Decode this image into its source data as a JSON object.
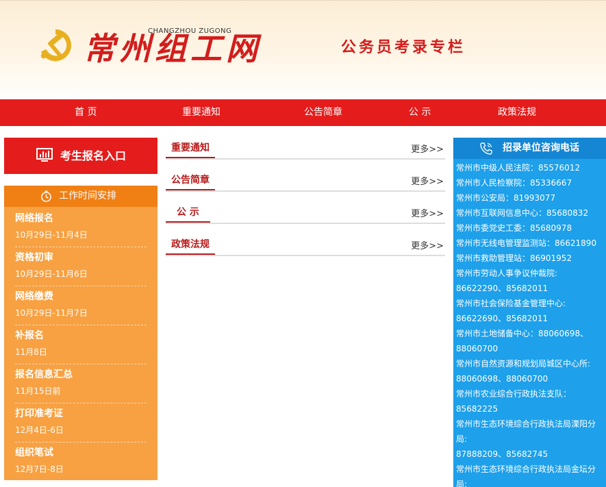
{
  "header": {
    "logo_text": "常州组工网",
    "logo_sub": "CHANGZHOU ZUGONG",
    "column_title": "公务员考录专栏"
  },
  "nav": {
    "items": [
      "首 页",
      "重要通知",
      "公告简章",
      "公 示",
      "政策法规"
    ]
  },
  "apply": {
    "label": "考生报名入口",
    "icon": "chart-screen-icon"
  },
  "schedule": {
    "title": "工作时间安排",
    "icon": "clock-icon",
    "items": [
      {
        "name": "网络报名",
        "date": "10月29日-11月4日"
      },
      {
        "name": "资格初审",
        "date": "10月29日-11月6日"
      },
      {
        "name": "网络缴费",
        "date": "10月29日-11月7日"
      },
      {
        "name": "补报名",
        "date": "11月8日"
      },
      {
        "name": "报名信息汇总",
        "date": "11月15日前"
      },
      {
        "name": "打印准考证",
        "date": "12月4日-6日"
      },
      {
        "name": "组织笔试",
        "date": "12月7日-8日"
      }
    ]
  },
  "sections": [
    {
      "title": "重要通知",
      "more": "更多>>"
    },
    {
      "title": "公告简章",
      "more": "更多>>"
    },
    {
      "title": "公 示",
      "more": "更多>>"
    },
    {
      "title": "政策法规",
      "more": "更多>>"
    }
  ],
  "phones": {
    "title": "招录单位咨询电话",
    "icon": "phone-icon",
    "lines": [
      "常州市中级人民法院：85576012",
      "常州市人民检察院：85336667",
      "常州市公安局：81993077",
      "常州市互联网信息中心：85680832",
      "常州市委党史工委：85680978",
      "常州市无线电管理监测站：86621890",
      "常州市救助管理站：86901952",
      "常州市劳动人事争议仲裁院:",
      "86622290、85682011",
      "常州市社会保险基金管理中心:",
      "86622690、85682011",
      "常州市土地储备中心：88060698、",
      "88060700",
      "常州市自然资源和规划局城区中心所:",
      "88060698、88060700",
      "常州市农业综合行政执法支队：",
      "85682225",
      "常州市生态环境综合行政执法局溧阳分",
      "局:",
      "87888209、85682745",
      "常州市生态环境综合行政执法局金坛分",
      "局:"
    ]
  },
  "colors": {
    "brand_red": "#e41c1c",
    "orange": "#f7a143",
    "orange_dark": "#f07f14",
    "blue": "#1ea0ea",
    "blue_dark": "#1486d4"
  }
}
